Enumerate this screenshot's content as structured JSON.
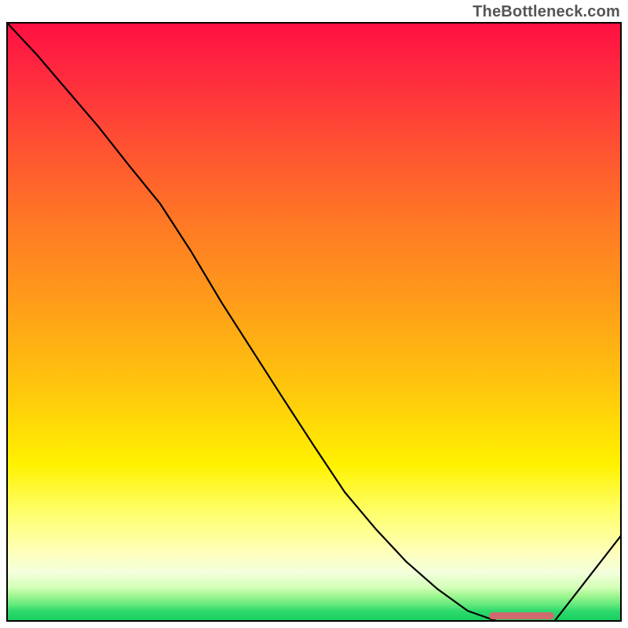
{
  "watermark": "TheBottleneck.com",
  "chart_data": {
    "type": "line",
    "title": "",
    "xlabel": "",
    "ylabel": "",
    "x": [
      0.0,
      0.05,
      0.1,
      0.15,
      0.2,
      0.25,
      0.3,
      0.35,
      0.4,
      0.45,
      0.5,
      0.55,
      0.6,
      0.65,
      0.7,
      0.75,
      0.8,
      0.83,
      0.86,
      0.89,
      1.0
    ],
    "values": [
      1.0,
      0.945,
      0.885,
      0.825,
      0.76,
      0.697,
      0.618,
      0.532,
      0.452,
      0.372,
      0.293,
      0.216,
      0.155,
      0.1,
      0.055,
      0.018,
      0.0,
      0.0,
      0.0,
      0.0,
      0.145
    ],
    "xlim": [
      0,
      1
    ],
    "ylim": [
      0,
      1
    ],
    "annotations": [
      {
        "kind": "band",
        "xmin": 0.785,
        "xmax": 0.89,
        "y": 0.0,
        "color": "#d16a6f"
      }
    ],
    "background": "vertical-gradient-red-to-green",
    "legend": null
  },
  "colors": {
    "frame": "#000000",
    "curve": "#000000",
    "marker": "#d16a6f"
  }
}
